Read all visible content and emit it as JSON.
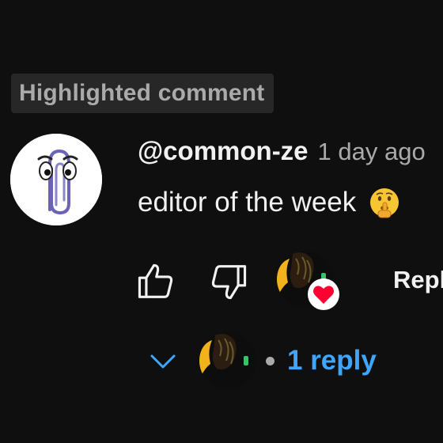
{
  "badge": {
    "label": "Highlighted comment"
  },
  "comment": {
    "author": "@common-ze",
    "time": "1 day ago",
    "text": "editor of the week",
    "emoji": "shushing-face-emoji",
    "author_avatar": "paperclip-avatar",
    "creator_heart": true
  },
  "actions": {
    "like_icon": "thumbs-up-icon",
    "dislike_icon": "thumbs-down-icon",
    "reply_label": "Reply"
  },
  "replies": {
    "count_label": "1 reply",
    "expand_icon": "chevron-down-icon"
  },
  "colors": {
    "background": "#0f0f0f",
    "link": "#3ea6ff",
    "secondary_text": "#aaaaaa",
    "heart": "#ff0033"
  }
}
